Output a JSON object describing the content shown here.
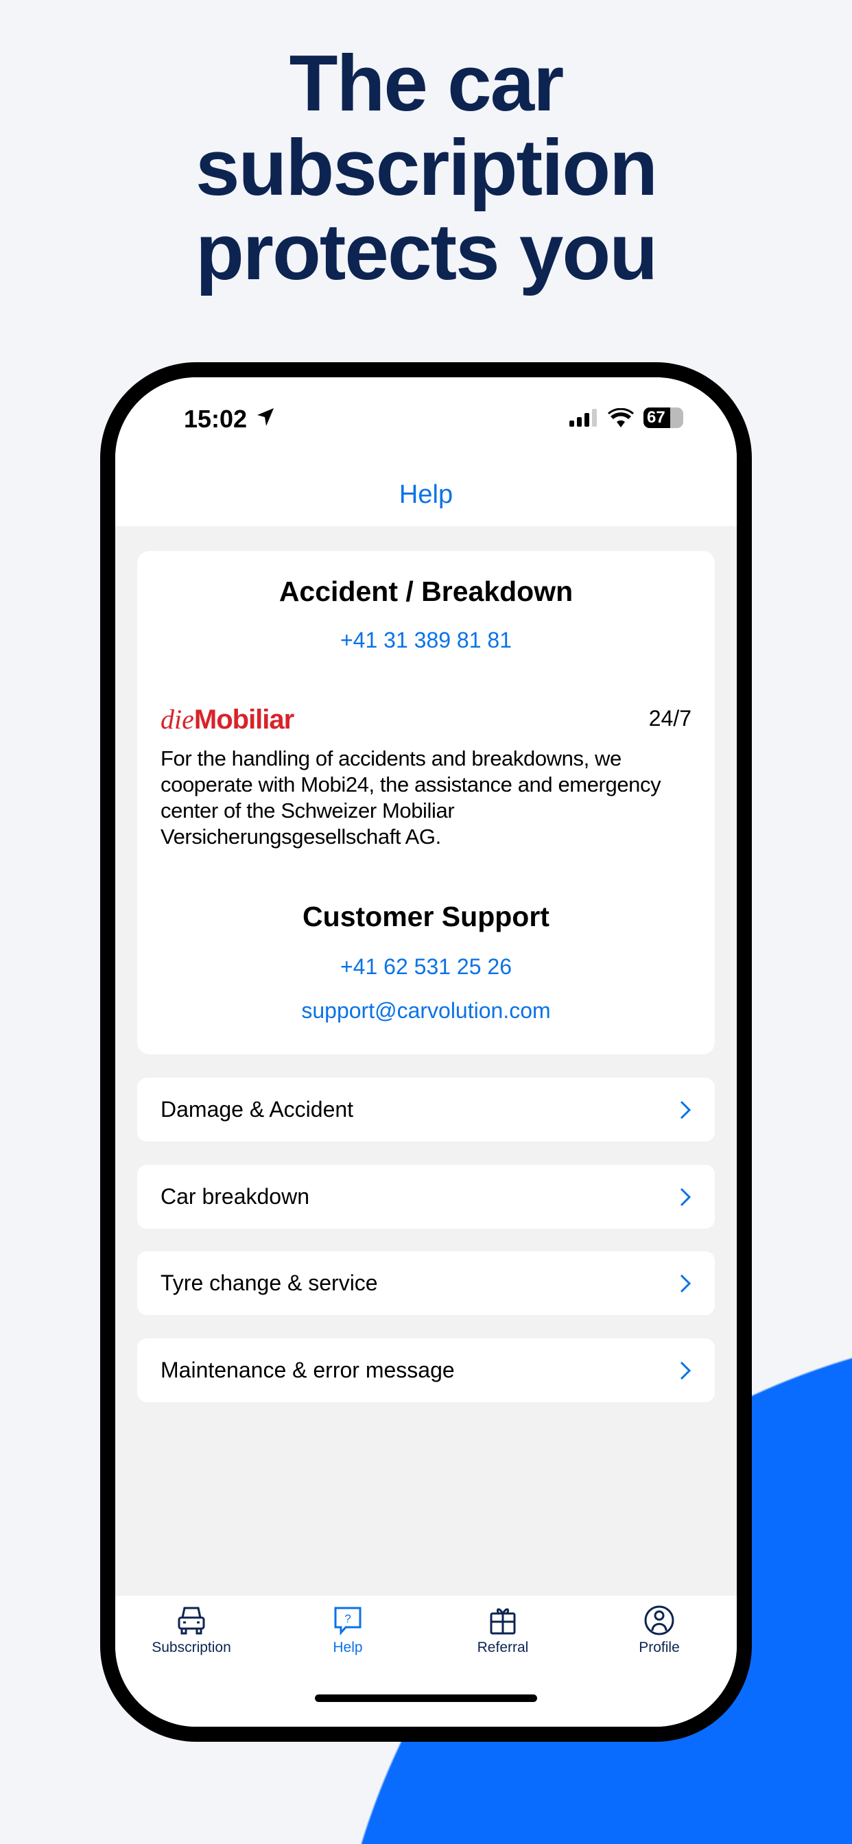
{
  "headline": [
    "The car",
    "subscription",
    "protects you"
  ],
  "status_bar": {
    "time": "15:02",
    "battery": "67"
  },
  "nav": {
    "title": "Help"
  },
  "card": {
    "accident_title": "Accident / Breakdown",
    "accident_phone": "+41 31 389 81 81",
    "partner_logo": {
      "prefix": "die",
      "name": "Mobiliar"
    },
    "availability": "24/7",
    "description": "For the handling of accidents and breakdowns, we cooperate with Mobi24, the assistance and emergency center of the Schweizer Mobiliar Versicherungsgesellschaft AG.",
    "support_title": "Customer Support",
    "support_phone": "+41 62 531 25 26",
    "support_email": "support@carvolution.com"
  },
  "menu": [
    {
      "label": "Damage & Accident"
    },
    {
      "label": "Car breakdown"
    },
    {
      "label": "Tyre change & service"
    },
    {
      "label": "Maintenance & error message"
    }
  ],
  "tabs": [
    {
      "label": "Subscription",
      "icon": "car-icon"
    },
    {
      "label": "Help",
      "icon": "help-bubble-icon",
      "active": true
    },
    {
      "label": "Referral",
      "icon": "gift-icon"
    },
    {
      "label": "Profile",
      "icon": "profile-icon"
    }
  ],
  "colors": {
    "accent": "#0a72e8",
    "headline": "#0d2451",
    "brand_red": "#d8232a",
    "background_blob": "#0a6cff"
  }
}
